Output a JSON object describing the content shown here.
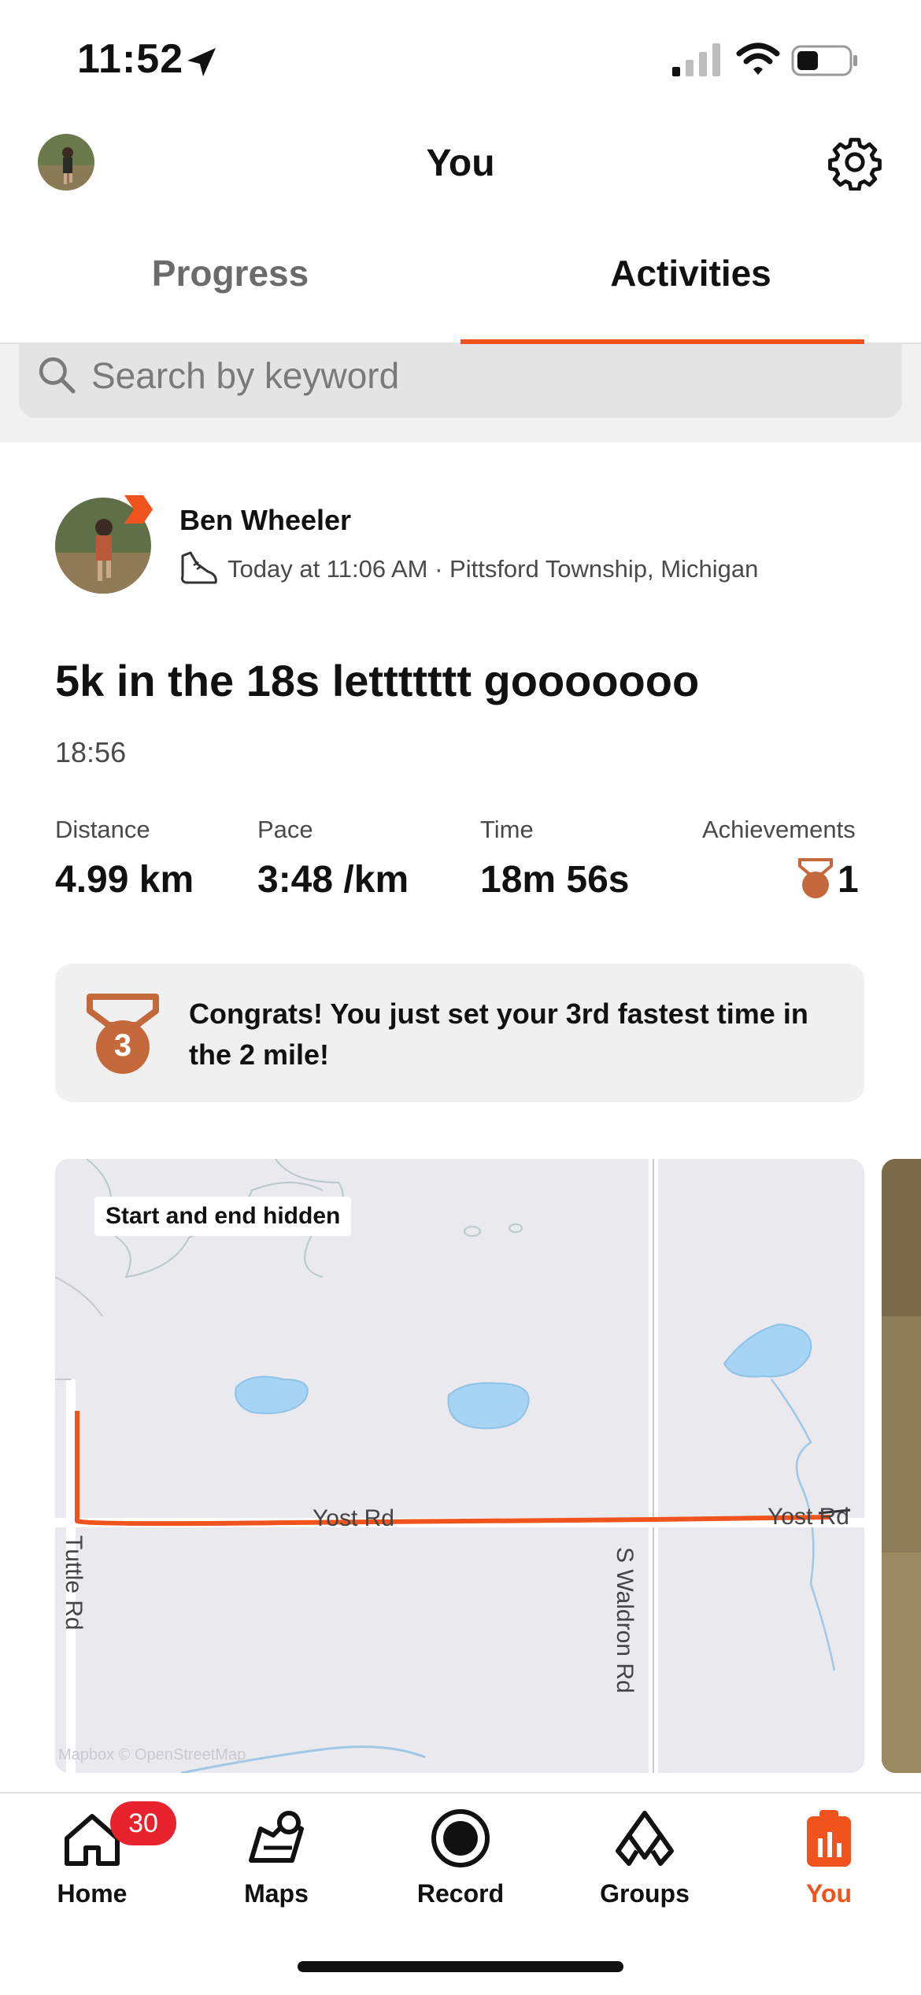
{
  "status_bar": {
    "time": "11:52"
  },
  "header": {
    "title": "You"
  },
  "tabs": [
    {
      "label": "Progress",
      "active": false
    },
    {
      "label": "Activities",
      "active": true
    }
  ],
  "search": {
    "placeholder": "Search by keyword"
  },
  "activity": {
    "athlete_name": "Ben Wheeler",
    "meta": "Today at 11:06 AM · Pittsford Township, Michigan",
    "title": "5k in the 18s lettttttt gooooooo",
    "time_of_day": "18:56",
    "stats": [
      {
        "label": "Distance",
        "value": "4.99 km"
      },
      {
        "label": "Pace",
        "value": "3:48 /km"
      },
      {
        "label": "Time",
        "value": "18m 56s"
      },
      {
        "label": "Achievements",
        "value": "1"
      }
    ],
    "congrats": {
      "medal_number": "3",
      "text": "Congrats! You just set your 3rd fastest time in the 2 mile!"
    }
  },
  "map": {
    "privacy_label": "Start and end hidden",
    "roads": [
      "Yost Rd",
      "S Waldron Rd",
      "Tuttle Rd",
      "Yost Rd"
    ],
    "credit": "Mapbox © OpenStreetMap",
    "route_color": "#f0541c"
  },
  "bottom_nav": {
    "items": [
      {
        "label": "Home",
        "icon": "home-icon",
        "active": false
      },
      {
        "label": "Maps",
        "icon": "maps-icon",
        "active": false
      },
      {
        "label": "Record",
        "icon": "record-icon",
        "active": false
      },
      {
        "label": "Groups",
        "icon": "groups-icon",
        "active": false
      },
      {
        "label": "You",
        "icon": "you-icon",
        "active": true
      }
    ],
    "home_badge": "30"
  },
  "colors": {
    "accent": "#f0541c",
    "medal": "#c4693c",
    "badge": "#e8232e"
  }
}
